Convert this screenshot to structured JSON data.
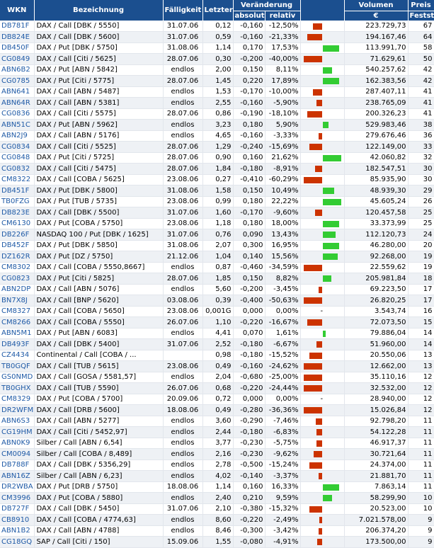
{
  "headers": {
    "wkn": "WKN",
    "bezeichnung": "Bezeichnung",
    "faelligkeit": "Fälligkeit",
    "letzter": "Letzter",
    "veraenderung": "Veränderung",
    "absolut": "absolut",
    "relativ": "relativ",
    "volumen": "Volumen",
    "volumen_unit": "€",
    "preis_line1": "Preis",
    "preis_line2": "Festst."
  },
  "colors": {
    "header_bg": "#1b4f8f",
    "neg": "#cc3300",
    "pos": "#33cc33",
    "wkn": "#1f5aa6"
  },
  "rows": [
    {
      "wkn": "DB781F",
      "name": "DAX / Call [DBK / 5550]",
      "date": "31.07.06",
      "last": "0,12",
      "abs": "-0,160",
      "rel": "-12,50%",
      "dir": "neg",
      "mag": 0.5,
      "vol": "223.729,73",
      "fest": "67"
    },
    {
      "wkn": "DB824E",
      "name": "DAX / Call [DBK / 5600]",
      "date": "31.07.06",
      "last": "0,59",
      "abs": "-0,160",
      "rel": "-21,33%",
      "dir": "neg",
      "mag": 0.8,
      "vol": "194.167,46",
      "fest": "64"
    },
    {
      "wkn": "DB450F",
      "name": "DAX / Put [DBK / 5750]",
      "date": "31.08.06",
      "last": "1,14",
      "abs": "0,170",
      "rel": "17,53%",
      "dir": "pos",
      "mag": 0.9,
      "vol": "113.991,70",
      "fest": "58"
    },
    {
      "wkn": "CG0849",
      "name": "DAX / Call [Citi / 5625]",
      "date": "28.07.06",
      "last": "0,30",
      "abs": "-0,200",
      "rel": "-40,00%",
      "dir": "neg",
      "mag": 1.0,
      "vol": "71.629,61",
      "fest": "50"
    },
    {
      "wkn": "ABN6B2",
      "name": "DAX / Put [ABN / 5842]",
      "date": "endlos",
      "last": "2,00",
      "abs": "0,150",
      "rel": "8,11%",
      "dir": "pos",
      "mag": 0.5,
      "vol": "540.257,62",
      "fest": "42"
    },
    {
      "wkn": "CG0785",
      "name": "DAX / Put [Citi / 5775]",
      "date": "28.07.06",
      "last": "1,45",
      "abs": "0,220",
      "rel": "17,89%",
      "dir": "pos",
      "mag": 0.9,
      "vol": "162.383,56",
      "fest": "42"
    },
    {
      "wkn": "ABN641",
      "name": "DAX / Call [ABN / 5487]",
      "date": "endlos",
      "last": "1,53",
      "abs": "-0,170",
      "rel": "-10,00%",
      "dir": "neg",
      "mag": 0.5,
      "vol": "287.407,11",
      "fest": "41"
    },
    {
      "wkn": "ABN64R",
      "name": "DAX / Call [ABN / 5381]",
      "date": "endlos",
      "last": "2,55",
      "abs": "-0,160",
      "rel": "-5,90%",
      "dir": "neg",
      "mag": 0.3,
      "vol": "238.765,09",
      "fest": "41"
    },
    {
      "wkn": "CG0836",
      "name": "DAX / Call [Citi / 5575]",
      "date": "28.07.06",
      "last": "0,86",
      "abs": "-0,190",
      "rel": "-18,10%",
      "dir": "neg",
      "mag": 0.8,
      "vol": "200.326,23",
      "fest": "41"
    },
    {
      "wkn": "ABN51C",
      "name": "DAX / Put [ABN / 5962]",
      "date": "endlos",
      "last": "3,23",
      "abs": "0,180",
      "rel": "5,90%",
      "dir": "pos",
      "mag": 0.3,
      "vol": "529.983,46",
      "fest": "38"
    },
    {
      "wkn": "ABN2J9",
      "name": "DAX / Call [ABN / 5176]",
      "date": "endlos",
      "last": "4,65",
      "abs": "-0,160",
      "rel": "-3,33%",
      "dir": "neg",
      "mag": 0.2,
      "vol": "279.676,46",
      "fest": "36"
    },
    {
      "wkn": "CG0834",
      "name": "DAX / Call [Citi / 5525]",
      "date": "28.07.06",
      "last": "1,29",
      "abs": "-0,240",
      "rel": "-15,69%",
      "dir": "neg",
      "mag": 0.7,
      "vol": "122.149,00",
      "fest": "33"
    },
    {
      "wkn": "CG0848",
      "name": "DAX / Put [Citi / 5725]",
      "date": "28.07.06",
      "last": "0,90",
      "abs": "0,160",
      "rel": "21,62%",
      "dir": "pos",
      "mag": 1.0,
      "vol": "42.060,82",
      "fest": "32"
    },
    {
      "wkn": "CG0832",
      "name": "DAX / Call [Citi / 5475]",
      "date": "28.07.06",
      "last": "1,84",
      "abs": "-0,180",
      "rel": "-8,91%",
      "dir": "neg",
      "mag": 0.4,
      "vol": "182.547,51",
      "fest": "30"
    },
    {
      "wkn": "CM8322",
      "name": "DAX / Call [COBA / 5625]",
      "date": "23.08.06",
      "last": "0,27",
      "abs": "-0,410",
      "rel": "-60,29%",
      "dir": "neg",
      "mag": 1.0,
      "vol": "85.935,90",
      "fest": "30"
    },
    {
      "wkn": "DB451F",
      "name": "DAX / Put [DBK / 5800]",
      "date": "31.08.06",
      "last": "1,58",
      "abs": "0,150",
      "rel": "10,49%",
      "dir": "pos",
      "mag": 0.6,
      "vol": "48.939,30",
      "fest": "29"
    },
    {
      "wkn": "TB0FZG",
      "name": "DAX / Put [TUB / 5735]",
      "date": "23.08.06",
      "last": "0,99",
      "abs": "0,180",
      "rel": "22,22%",
      "dir": "pos",
      "mag": 1.0,
      "vol": "45.605,24",
      "fest": "26"
    },
    {
      "wkn": "DB823E",
      "name": "DAX / Call [DBK / 5500]",
      "date": "31.07.06",
      "last": "1,60",
      "abs": "-0,170",
      "rel": "-9,60%",
      "dir": "neg",
      "mag": 0.4,
      "vol": "120.457,58",
      "fest": "25"
    },
    {
      "wkn": "CM6130",
      "name": "DAX / Put [COBA / 5750]",
      "date": "23.08.06",
      "last": "1,18",
      "abs": "0,180",
      "rel": "18,00%",
      "dir": "pos",
      "mag": 0.9,
      "vol": "33.373,99",
      "fest": "25"
    },
    {
      "wkn": "DB226F",
      "name": "NASDAQ 100 / Put [DBK / 1625]",
      "date": "31.07.06",
      "last": "0,76",
      "abs": "0,090",
      "rel": "13,43%",
      "dir": "pos",
      "mag": 0.7,
      "vol": "112.120,73",
      "fest": "24"
    },
    {
      "wkn": "DB452F",
      "name": "DAX / Put [DBK / 5850]",
      "date": "31.08.06",
      "last": "2,07",
      "abs": "0,300",
      "rel": "16,95%",
      "dir": "pos",
      "mag": 0.9,
      "vol": "46.280,00",
      "fest": "20"
    },
    {
      "wkn": "DZ162R",
      "name": "DAX / Put [DZ / 5750]",
      "date": "21.12.06",
      "last": "1,04",
      "abs": "0,140",
      "rel": "15,56%",
      "dir": "pos",
      "mag": 0.8,
      "vol": "92.268,00",
      "fest": "19"
    },
    {
      "wkn": "CM8302",
      "name": "DAX / Call [COBA / 5550,8667]",
      "date": "endlos",
      "last": "0,87",
      "abs": "-0,460",
      "rel": "-34,59%",
      "dir": "neg",
      "mag": 1.0,
      "vol": "22.559,62",
      "fest": "19"
    },
    {
      "wkn": "CG0823",
      "name": "DAX / Put [Citi / 5825]",
      "date": "28.07.06",
      "last": "1,85",
      "abs": "0,150",
      "rel": "8,82%",
      "dir": "pos",
      "mag": 0.45,
      "vol": "205.981,84",
      "fest": "18"
    },
    {
      "wkn": "ABN2DP",
      "name": "DAX / Call [ABN / 5076]",
      "date": "endlos",
      "last": "5,60",
      "abs": "-0,200",
      "rel": "-3,45%",
      "dir": "neg",
      "mag": 0.2,
      "vol": "69.223,50",
      "fest": "17"
    },
    {
      "wkn": "BN7X8J",
      "name": "DAX / Call [BNP / 5620]",
      "date": "03.08.06",
      "last": "0,39",
      "abs": "-0,400",
      "rel": "-50,63%",
      "dir": "neg",
      "mag": 1.0,
      "vol": "26.820,25",
      "fest": "17"
    },
    {
      "wkn": "CM8327",
      "name": "DAX / Call [COBA / 5650]",
      "date": "23.08.06",
      "last": "0,001G",
      "abs": "0,000",
      "rel": "0,00%",
      "dir": "zero",
      "mag": 0,
      "vol": "3.543,74",
      "fest": "16"
    },
    {
      "wkn": "CM8266",
      "name": "DAX / Call [COBA / 5550]",
      "date": "26.07.06",
      "last": "1,10",
      "abs": "-0,220",
      "rel": "-16,67%",
      "dir": "neg",
      "mag": 0.8,
      "vol": "72.073,50",
      "fest": "15"
    },
    {
      "wkn": "ABN5M1",
      "name": "DAX / Put [ABN / 6083]",
      "date": "endlos",
      "last": "4,41",
      "abs": "0,070",
      "rel": "1,61%",
      "dir": "pos",
      "mag": 0.15,
      "vol": "79.886,04",
      "fest": "14"
    },
    {
      "wkn": "DB493F",
      "name": "DAX / Call [DBK / 5400]",
      "date": "31.07.06",
      "last": "2,52",
      "abs": "-0,180",
      "rel": "-6,67%",
      "dir": "neg",
      "mag": 0.3,
      "vol": "51.960,00",
      "fest": "14"
    },
    {
      "wkn": "CZ4434",
      "name": "Continental / Call [COBA / ...",
      "date": "",
      "last": "0,98",
      "abs": "-0,180",
      "rel": "-15,52%",
      "dir": "neg",
      "mag": 0.7,
      "vol": "20.550,06",
      "fest": "13"
    },
    {
      "wkn": "TB0GQF",
      "name": "DAX / Call [TUB / 5615]",
      "date": "23.08.06",
      "last": "0,49",
      "abs": "-0,160",
      "rel": "-24,62%",
      "dir": "neg",
      "mag": 1.0,
      "vol": "12.662,00",
      "fest": "13"
    },
    {
      "wkn": "GS0NMD",
      "name": "DAX / Call [GOSA / 5581,57]",
      "date": "endlos",
      "last": "2,04",
      "abs": "-0,680",
      "rel": "-25,00%",
      "dir": "neg",
      "mag": 1.0,
      "vol": "35.110,16",
      "fest": "12"
    },
    {
      "wkn": "TB0GHX",
      "name": "DAX / Call [TUB / 5590]",
      "date": "26.07.06",
      "last": "0,68",
      "abs": "-0,220",
      "rel": "-24,44%",
      "dir": "neg",
      "mag": 1.0,
      "vol": "32.532,00",
      "fest": "12"
    },
    {
      "wkn": "CM8329",
      "name": "DAX / Put [COBA / 5700]",
      "date": "20.09.06",
      "last": "0,72",
      "abs": "0,000",
      "rel": "0,00%",
      "dir": "zero",
      "mag": 0,
      "vol": "28.940,00",
      "fest": "12"
    },
    {
      "wkn": "DR2WFM",
      "name": "DAX / Call [DRB / 5600]",
      "date": "18.08.06",
      "last": "0,49",
      "abs": "-0,280",
      "rel": "-36,36%",
      "dir": "neg",
      "mag": 1.0,
      "vol": "15.026,84",
      "fest": "12"
    },
    {
      "wkn": "ABN6S3",
      "name": "DAX / Call [ABN / 5277]",
      "date": "endlos",
      "last": "3,60",
      "abs": "-0,290",
      "rel": "-7,46%",
      "dir": "neg",
      "mag": 0.35,
      "vol": "92.798,20",
      "fest": "11"
    },
    {
      "wkn": "CG19HM",
      "name": "DAX / Call [Citi / 5452,97]",
      "date": "endlos",
      "last": "2,44",
      "abs": "-0,180",
      "rel": "-6,83%",
      "dir": "neg",
      "mag": 0.3,
      "vol": "54.122,28",
      "fest": "11"
    },
    {
      "wkn": "ABN0K9",
      "name": "Silber / Call [ABN / 6,54]",
      "date": "endlos",
      "last": "3,77",
      "abs": "-0,230",
      "rel": "-5,75%",
      "dir": "neg",
      "mag": 0.3,
      "vol": "46.917,37",
      "fest": "11"
    },
    {
      "wkn": "CM0094",
      "name": "Silber / Call [COBA / 8,489]",
      "date": "endlos",
      "last": "2,16",
      "abs": "-0,230",
      "rel": "-9,62%",
      "dir": "neg",
      "mag": 0.45,
      "vol": "30.721,64",
      "fest": "11"
    },
    {
      "wkn": "DB788F",
      "name": "DAX / Call [DBK / 5356,29]",
      "date": "endlos",
      "last": "2,78",
      "abs": "-0,500",
      "rel": "-15,24%",
      "dir": "neg",
      "mag": 0.7,
      "vol": "24.374,00",
      "fest": "11"
    },
    {
      "wkn": "ABN16Z",
      "name": "Silber / Call [ABN / 6,23]",
      "date": "endlos",
      "last": "4,02",
      "abs": "-0,140",
      "rel": "-3,37%",
      "dir": "neg",
      "mag": 0.2,
      "vol": "21.881,70",
      "fest": "11"
    },
    {
      "wkn": "DR2WBA",
      "name": "DAX / Put [DRB / 5750]",
      "date": "18.08.06",
      "last": "1,14",
      "abs": "0,160",
      "rel": "16,33%",
      "dir": "pos",
      "mag": 0.9,
      "vol": "7.863,14",
      "fest": "11"
    },
    {
      "wkn": "CM3996",
      "name": "DAX / Put [COBA / 5880]",
      "date": "endlos",
      "last": "2,40",
      "abs": "0,210",
      "rel": "9,59%",
      "dir": "pos",
      "mag": 0.5,
      "vol": "58.299,90",
      "fest": "10"
    },
    {
      "wkn": "DB727F",
      "name": "DAX / Call [DBK / 5450]",
      "date": "31.07.06",
      "last": "2,10",
      "abs": "-0,380",
      "rel": "-15,32%",
      "dir": "neg",
      "mag": 0.7,
      "vol": "20.523,00",
      "fest": "10"
    },
    {
      "wkn": "CB8910",
      "name": "DAX / Call [COBA / 4774,63]",
      "date": "endlos",
      "last": "8,60",
      "abs": "-0,220",
      "rel": "-2,49%",
      "dir": "neg",
      "mag": 0.15,
      "vol": "7.021.578,00",
      "fest": "9"
    },
    {
      "wkn": "ABN1B2",
      "name": "DAX / Call [ABN / 4788]",
      "date": "endlos",
      "last": "8,46",
      "abs": "-0,300",
      "rel": "-3,42%",
      "dir": "neg",
      "mag": 0.2,
      "vol": "206.374,20",
      "fest": "9"
    },
    {
      "wkn": "CG18GQ",
      "name": "SAP / Call [Citi / 150]",
      "date": "15.09.06",
      "last": "1,55",
      "abs": "-0,080",
      "rel": "-4,91%",
      "dir": "neg",
      "mag": 0.25,
      "vol": "173.500,00",
      "fest": "9"
    }
  ]
}
